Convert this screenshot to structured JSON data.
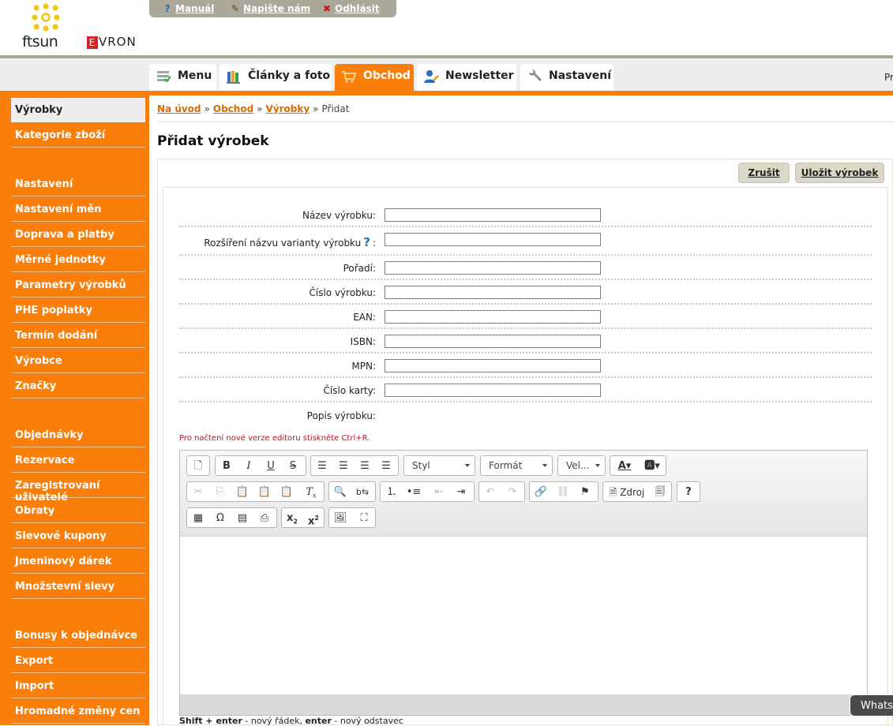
{
  "header": {
    "logo_text": "ftsun",
    "evron_e": "E",
    "evron_rest": "VRON",
    "toplinks": [
      {
        "label": "Manuál",
        "icon": "help-icon"
      },
      {
        "label": "Napište nám",
        "icon": "write-icon"
      },
      {
        "label": "Odhlásit",
        "icon": "logout-icon"
      }
    ]
  },
  "tabs": [
    {
      "label": "Menu",
      "icon": "menu-stack-icon"
    },
    {
      "label": "Články a foto",
      "icon": "books-icon"
    },
    {
      "label": "Obchod",
      "icon": "cart-icon",
      "active": true
    },
    {
      "label": "Newsletter",
      "icon": "user-edit-icon"
    },
    {
      "label": "Nastavení",
      "icon": "wrench-icon"
    }
  ],
  "tab_right_text": "Pr",
  "sidebar": {
    "items": [
      "Výrobky",
      "Kategorie zboží",
      "Nastavení",
      "Nastavení měn",
      "Doprava a platby",
      "Měrné jednotky",
      "Parametry výrobků",
      "PHE poplatky",
      "Termín dodání",
      "Výrobce",
      "Značky",
      "Objednávky",
      "Rezervace",
      "Zaregistrovaní uživatelé",
      "Obraty",
      "Slevové kupony",
      "Jmeninový dárek",
      "Množstevní slevy",
      "Bonusy k objednávce",
      "Export",
      "Import",
      "Hromadné změny cen"
    ]
  },
  "breadcrumb": {
    "items": [
      "Na úvod",
      "Obchod",
      "Výrobky"
    ],
    "current": "Přidat",
    "separator": "»"
  },
  "page_title": "Přidat výrobek",
  "buttons": {
    "cancel": "Zrušit",
    "save": "Uložit výrobek"
  },
  "form": {
    "fields": [
      {
        "label": "Název výrobku:",
        "value": ""
      },
      {
        "label": "Rozšíření názvu varianty výrobku",
        "suffix": ":",
        "value": ""
      },
      {
        "label": "Pořadí:",
        "value": ""
      },
      {
        "label": "Číslo výrobku:",
        "value": ""
      },
      {
        "label": "EAN:",
        "value": ""
      },
      {
        "label": "ISBN:",
        "value": ""
      },
      {
        "label": "MPN:",
        "value": ""
      },
      {
        "label": "Číslo karty:",
        "value": ""
      }
    ],
    "help_glyph": "?",
    "description_label": "Popis výrobku:"
  },
  "editor": {
    "note": "Pro načtení nové verze editoru stiskněte Ctrl+R.",
    "style_combo": "Styl",
    "format_combo": "Formát",
    "size_combo": "Vel...",
    "source_label": "Zdroj"
  },
  "hint": {
    "k1": "Shift + enter",
    "t1": " - nový řádek, ",
    "k2": "enter",
    "t2": " - nový odstavec"
  },
  "whats_label": "Whats"
}
